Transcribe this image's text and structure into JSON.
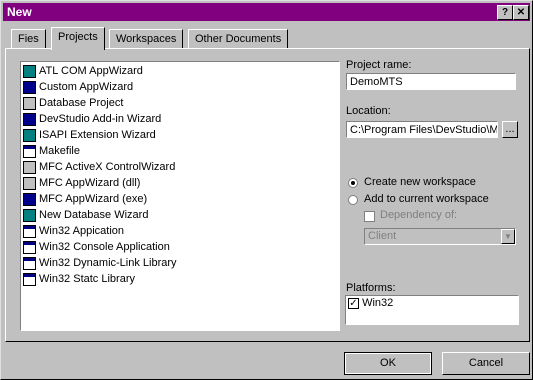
{
  "window": {
    "title": "New",
    "help_glyph": "?",
    "close_glyph": "✕"
  },
  "tabs": [
    {
      "label": "Fies",
      "active": false
    },
    {
      "label": "Projects",
      "active": true
    },
    {
      "label": "Workspaces",
      "active": false
    },
    {
      "label": "Other Documents",
      "active": false
    }
  ],
  "project_types": [
    {
      "label": "ATL COM AppWizard",
      "icon": "atl-icon"
    },
    {
      "label": "Custom AppWizard",
      "icon": "custom-appwizard-icon"
    },
    {
      "label": "Database Project",
      "icon": "database-icon"
    },
    {
      "label": "DevStudio Add-in Wizard",
      "icon": "addin-icon"
    },
    {
      "label": "ISAPI Extension Wizard",
      "icon": "isapi-icon"
    },
    {
      "label": "Makefile",
      "icon": "makefile-icon"
    },
    {
      "label": "MFC ActiveX ControlWizard",
      "icon": "activex-icon"
    },
    {
      "label": "MFC AppWizard (dll)",
      "icon": "mfc-dll-icon"
    },
    {
      "label": "MFC AppWizard (exe)",
      "icon": "mfc-exe-icon"
    },
    {
      "label": "New Database Wizard",
      "icon": "new-db-icon"
    },
    {
      "label": "Win32 Appication",
      "icon": "win32-app-icon"
    },
    {
      "label": "Win32 Console Application",
      "icon": "console-icon"
    },
    {
      "label": "Win32 Dynamic-Link Library",
      "icon": "dll-icon"
    },
    {
      "label": "Win32 Statc Library",
      "icon": "static-lib-icon"
    }
  ],
  "project_name": {
    "label": "Project rame:",
    "value": "DemoMTS"
  },
  "location": {
    "label": "Location:",
    "value": "C:\\Program Files\\DevStudio\\My",
    "browse_label": "..."
  },
  "workspace": {
    "create_new": "Create new workspace",
    "add_current": "Add to current workspace",
    "dependency": "Dependency of:",
    "dependency_value": "Client"
  },
  "platforms": {
    "label": "Platforms:",
    "items": [
      {
        "label": "Win32",
        "checked": true
      }
    ]
  },
  "buttons": {
    "ok": "OK",
    "cancel": "Cancel"
  },
  "colors": {
    "titlebar": "#800080",
    "face": "#c0c0c0"
  }
}
